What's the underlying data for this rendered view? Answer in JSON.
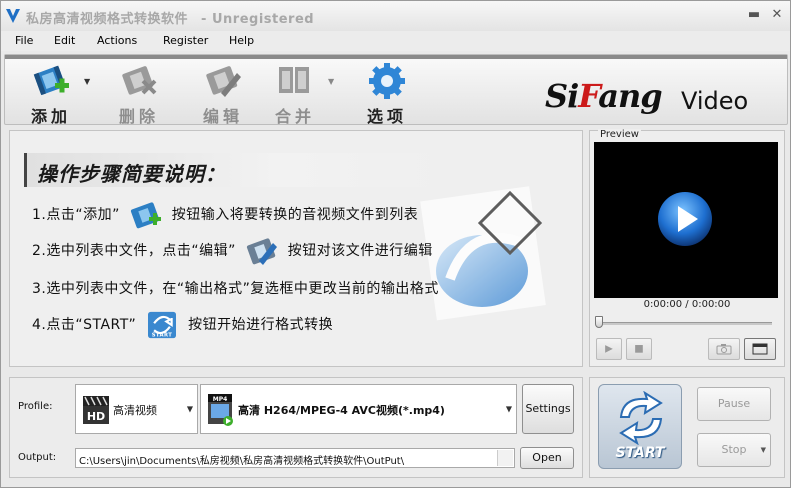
{
  "window": {
    "title": "私房高清视频格式转换软件",
    "subtitle": "- Unregistered",
    "minimize_glyph": "▬",
    "close_glyph": "✕"
  },
  "menu": {
    "items": [
      "File",
      "Edit",
      "Actions",
      "Register",
      "Help"
    ]
  },
  "toolbar": {
    "add_label": "添加",
    "delete_label": "删除",
    "edit_label": "编辑",
    "merge_label": "合并",
    "options_label": "选项",
    "brand_part1": "Si",
    "brand_part2": "F",
    "brand_part3": "ang",
    "brand_video": "Video"
  },
  "guide": {
    "title": "操作步骤简要说明：",
    "step1_a": "1.点击“添加”",
    "step1_b": "按钮输入将要转换的音视频文件到列表",
    "step2_a": "2.选中列表中文件，点击“编辑”",
    "step2_b": "按钮对该文件进行编辑",
    "step3": "3.选中列表中文件，在“输出格式”复选框中更改当前的输出格式",
    "step4_a": "4.点击“START”",
    "step4_b": "按钮开始进行格式转换",
    "start_icon_text": "START"
  },
  "preview": {
    "label": "Preview",
    "time": "0:00:00 / 0:00:00",
    "seek_position": 0
  },
  "profile": {
    "label": "Profile:",
    "category_icon_text": "HD",
    "category": "高清视频",
    "format_icon_text": "MP4",
    "format_prefix": "高清",
    "format": "H264/MPEG-4 AVC视频(*.mp4)",
    "settings_label": "Settings"
  },
  "output": {
    "label": "Output:",
    "path": "C:\\Users\\jin\\Documents\\私房视频\\私房高清视频格式转换软件\\OutPut\\",
    "open_label": "Open"
  },
  "controls": {
    "start_label": "START",
    "pause_label": "Pause",
    "stop_label": "Stop"
  },
  "colors": {
    "accent_blue": "#1f6fc5",
    "brand_red": "#cc1a1a",
    "add_green": "#3dae2b"
  }
}
